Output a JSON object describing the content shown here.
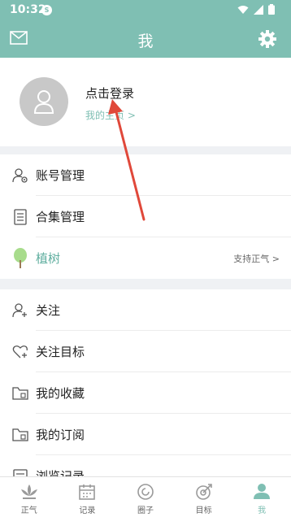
{
  "status_bar": {
    "time": "10:32",
    "notification_badge": "S"
  },
  "app_bar": {
    "title": "我",
    "mail_icon": "mail-icon",
    "settings_icon": "gear-icon"
  },
  "profile": {
    "login_label": "点击登录",
    "home_link": "我的主页 >"
  },
  "menu_group_1": [
    {
      "label": "账号管理",
      "icon": "user-gear-icon"
    },
    {
      "label": "合集管理",
      "icon": "document-icon"
    },
    {
      "label": "植树",
      "icon": "tree-icon",
      "extra": "支持正气 >",
      "label_color": "#5fae9f"
    }
  ],
  "menu_group_2": [
    {
      "label": "关注",
      "icon": "user-plus-icon"
    },
    {
      "label": "关注目标",
      "icon": "heart-plus-icon"
    },
    {
      "label": "我的收藏",
      "icon": "folder-icon"
    },
    {
      "label": "我的订阅",
      "icon": "folder-icon"
    },
    {
      "label": "浏览记录",
      "icon": "history-icon"
    }
  ],
  "bottom_nav": [
    {
      "label": "正气",
      "icon": "lotus-icon"
    },
    {
      "label": "记录",
      "icon": "calendar-icon"
    },
    {
      "label": "圈子",
      "icon": "circle-icon"
    },
    {
      "label": "目标",
      "icon": "target-icon"
    },
    {
      "label": "我",
      "icon": "person-icon",
      "active": true
    }
  ],
  "colors": {
    "accent": "#7fbfb3",
    "arrow": "#e0483a"
  }
}
